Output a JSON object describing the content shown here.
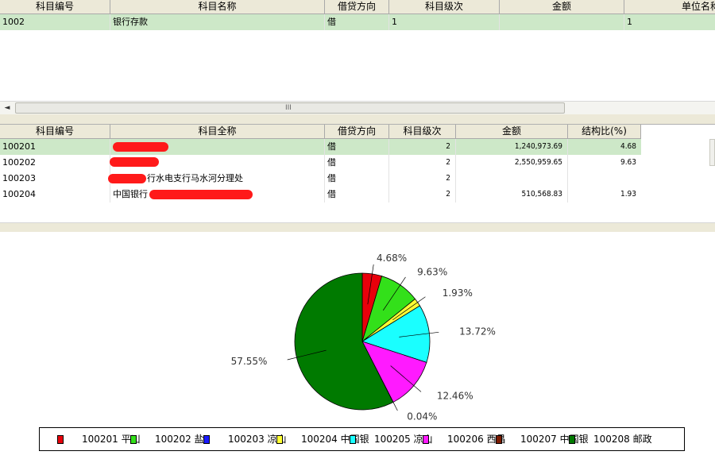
{
  "top_table": {
    "headers": [
      "科目编号",
      "科目名称",
      "借贷方向",
      "科目级次",
      "金额",
      "单位名称"
    ],
    "rows": [
      {
        "code": "1002",
        "name": "银行存款",
        "dir": "借",
        "level": "1",
        "amount": "",
        "unit": "1"
      }
    ]
  },
  "scroll_grip": "III",
  "scroll_left": "◄",
  "detail_table": {
    "headers": [
      "科目编号",
      "科目全称",
      "借贷方向",
      "科目级次",
      "金额",
      "结构比(%)"
    ],
    "rows": [
      {
        "code": "100201",
        "name": "",
        "dir": "借",
        "level": "2",
        "amount": "1,240,973.69",
        "ratio": "4.68"
      },
      {
        "code": "100202",
        "name": "",
        "dir": "借",
        "level": "2",
        "amount": "2,550,959.65",
        "ratio": "9.63"
      },
      {
        "code": "100203",
        "name": "行水电支行马水河分理处",
        "dir": "借",
        "level": "2",
        "amount": "",
        "ratio": ""
      },
      {
        "code": "100204",
        "name": "中国银行",
        "dir": "借",
        "level": "2",
        "amount": "510,568.83",
        "ratio": "1.93"
      }
    ]
  },
  "chart_data": {
    "type": "pie",
    "slices": [
      {
        "label": "100201 平凵",
        "value": 4.68,
        "text": "4.68%",
        "color": "#e8000b"
      },
      {
        "label": "100202 盐",
        "value": 9.63,
        "text": "9.63%",
        "color": "#33e01a"
      },
      {
        "label": "100203 凉山",
        "value": 1.93,
        "text": "1.93%",
        "color": "#ffff33"
      },
      {
        "label": "100204 中国银",
        "value": 13.72,
        "text": "13.72%",
        "color": "#1affff"
      },
      {
        "label": "100205 凉山",
        "value": 12.46,
        "text": "12.46%",
        "color": "#ff1aff"
      },
      {
        "label": "100206 西昌",
        "value": 0.04,
        "text": "0.04%",
        "color": "#7a1a00"
      },
      {
        "label": "100207 中国银",
        "value": 57.55,
        "text": "57.55%",
        "color": "#007a00"
      }
    ],
    "legend": [
      {
        "label": "100201 平凵",
        "color": "#e8000b"
      },
      {
        "label": "100202 盐",
        "color": "#33e01a"
      },
      {
        "label": "100203 凉山",
        "color": "#1a1aff"
      },
      {
        "label": "100204 中国银",
        "color": "#ffff33"
      },
      {
        "label": "100205 凉山",
        "color": "#1affff"
      },
      {
        "label": "100206 西昌",
        "color": "#ff1aff"
      },
      {
        "label": "100207 中国银",
        "color": "#7a1a00"
      },
      {
        "label": "100208 邮政",
        "color": "#007a00"
      }
    ]
  }
}
